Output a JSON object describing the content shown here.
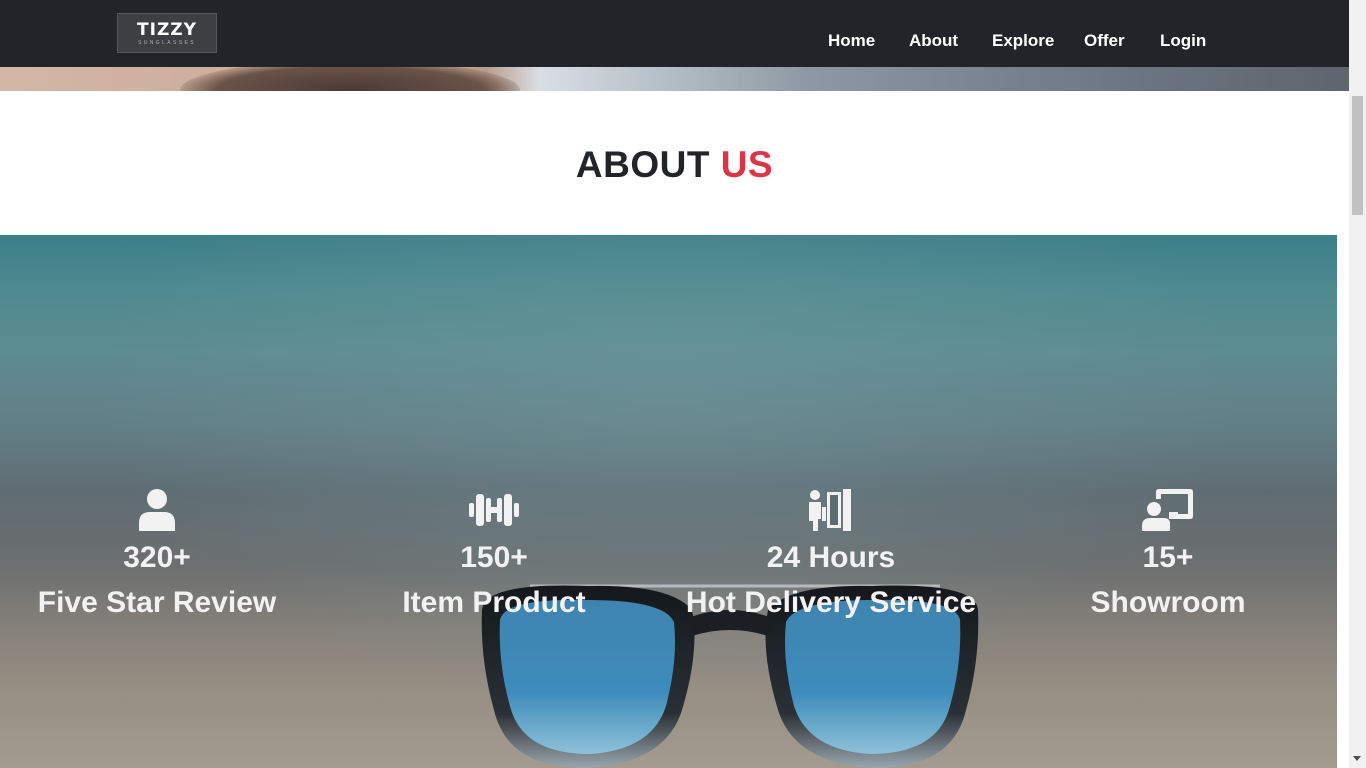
{
  "navbar": {
    "brand": "TIZZY",
    "brand_sub": "SUNGLASSES",
    "links": [
      "Home",
      "About",
      "Explore",
      "Offer",
      "Login"
    ]
  },
  "about": {
    "title_main": "ABOUT",
    "title_accent": "US"
  },
  "stats": [
    {
      "icon": "user-icon",
      "value": "320+",
      "label": "Five Star Review"
    },
    {
      "icon": "dumbbell-icon",
      "value": "150+",
      "label": "Item Product"
    },
    {
      "icon": "delivery-person-icon",
      "value": "24 Hours",
      "label": "Hot Delivery Service"
    },
    {
      "icon": "chalkboard-user-icon",
      "value": "15+",
      "label": "Showroom"
    }
  ],
  "colors": {
    "navbar": "#212529",
    "accent": "#dc3545",
    "text_dark": "#212529",
    "stat_text": "#f2f2f2"
  }
}
